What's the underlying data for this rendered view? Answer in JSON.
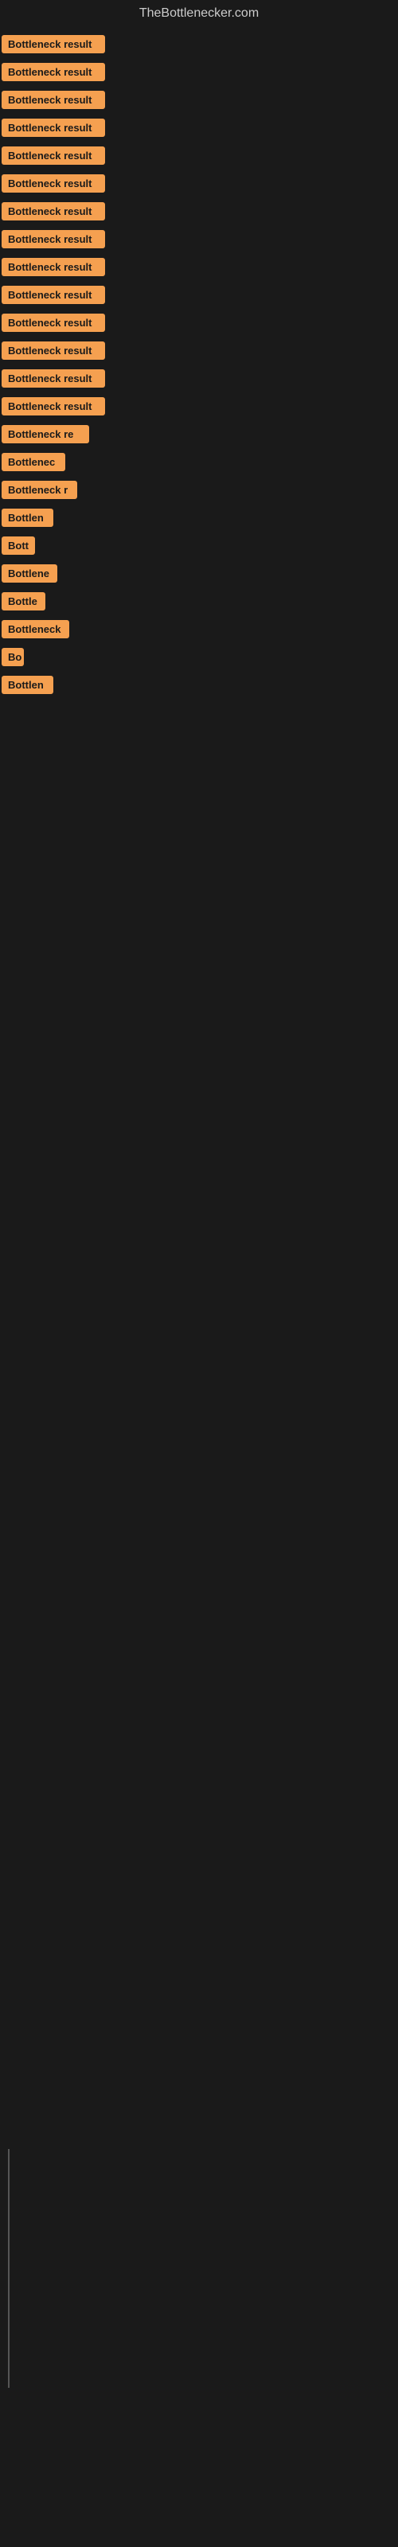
{
  "header": {
    "title": "TheBottlenecker.com"
  },
  "rows": [
    {
      "label": "Bottleneck result",
      "width": 130
    },
    {
      "label": "Bottleneck result",
      "width": 130
    },
    {
      "label": "Bottleneck result",
      "width": 130
    },
    {
      "label": "Bottleneck result",
      "width": 130
    },
    {
      "label": "Bottleneck result",
      "width": 130
    },
    {
      "label": "Bottleneck result",
      "width": 130
    },
    {
      "label": "Bottleneck result",
      "width": 130
    },
    {
      "label": "Bottleneck result",
      "width": 130
    },
    {
      "label": "Bottleneck result",
      "width": 130
    },
    {
      "label": "Bottleneck result",
      "width": 130
    },
    {
      "label": "Bottleneck result",
      "width": 130
    },
    {
      "label": "Bottleneck result",
      "width": 130
    },
    {
      "label": "Bottleneck result",
      "width": 130
    },
    {
      "label": "Bottleneck result",
      "width": 130
    },
    {
      "label": "Bottleneck re",
      "width": 110
    },
    {
      "label": "Bottlenec",
      "width": 80
    },
    {
      "label": "Bottleneck r",
      "width": 95
    },
    {
      "label": "Bottlen",
      "width": 65
    },
    {
      "label": "Bott",
      "width": 42
    },
    {
      "label": "Bottlene",
      "width": 70
    },
    {
      "label": "Bottle",
      "width": 55
    },
    {
      "label": "Bottleneck",
      "width": 85
    },
    {
      "label": "Bo",
      "width": 28
    },
    {
      "label": "Bottlen",
      "width": 65
    }
  ]
}
